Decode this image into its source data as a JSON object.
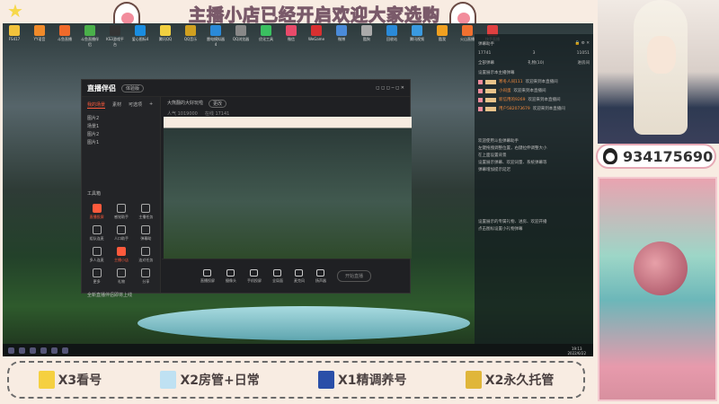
{
  "banner": {
    "title": "主播小店已经开启欢迎大家选购"
  },
  "desktop": {
    "icons": [
      "FS417",
      "YY语音",
      "斗鱼直播",
      "斗鱼直播伴侣",
      "KS3游戏平台",
      "爱心图标4",
      "腾讯QQ",
      "QQ音乐",
      "雷电模拟器4",
      "QQ浏览器",
      "优化工具",
      "微信",
      "WeGame",
      "微博",
      "酷狗",
      "回收站",
      "腾讯视频",
      "酷我",
      "火山直播",
      "快手直播"
    ]
  },
  "app": {
    "name": "直播伴侣",
    "version_pill": "体验版",
    "tabs": [
      "我的场景",
      "素材",
      "可选项"
    ],
    "scenes": [
      "图片2",
      "场景1",
      "图片2",
      "图片1"
    ],
    "room_title": "大熊翻的大好玩啦",
    "room_tag": "更改",
    "room_meta": [
      "人气 1019000",
      "在线 17141"
    ],
    "tools_title": "工具箱",
    "tools": [
      "直播投屏",
      "感觉助手",
      "主播任务",
      "组队连麦",
      "人口助手",
      "弹幕助",
      "多人连麦",
      "主播小店",
      "连对任务",
      "更多",
      "礼物",
      "分享"
    ],
    "notice": "全新直播伴侣即将上线",
    "controls": [
      "直播投屏",
      "摄像头",
      "手机投屏",
      "全局面",
      "麦克风",
      "扬声器"
    ],
    "live_button": "开始直播"
  },
  "chat": {
    "title": "弹幕助手",
    "stats": [
      "17741",
      "3",
      "11051"
    ],
    "tabs": [
      "全部弹幕",
      "礼物(10)",
      "进房间"
    ],
    "header": "设置展示本主播弹幕",
    "messages": [
      {
        "name": "寒冬人间111",
        "text": "欢迎来到本直播间"
      },
      {
        "name": "小闷蛋",
        "text": "欢迎来到本直播间"
      },
      {
        "name": "新信用的9269",
        "text": "欢迎来到本直播间"
      },
      {
        "name": "用户582073679",
        "text": "欢迎来到本直播间"
      }
    ],
    "help": [
      "欢迎使用斗鱼弹幕助手",
      "左键拖拽调整位置，右键拉伸调整大小",
      "在上面设置背景",
      "设置展示弹幕、欢迎词量、系统弹幕等",
      "弹幕增加提示延迟"
    ],
    "footer": [
      "设置展示的专属礼物、进房、欢迎开播",
      "点击图标设置小礼物弹幕"
    ]
  },
  "taskbar": {
    "time": "19:13",
    "date": "2022/6/22"
  },
  "contact": {
    "qq": "934175690"
  },
  "gifts": [
    {
      "label": "X3看号",
      "color": "#f5d040"
    },
    {
      "label": "X2房管+日常",
      "color": "#bfe1f2"
    },
    {
      "label": "X1精调养号",
      "color": "#2a4fa8"
    },
    {
      "label": "X2永久托管",
      "color": "#e0b63a"
    }
  ]
}
